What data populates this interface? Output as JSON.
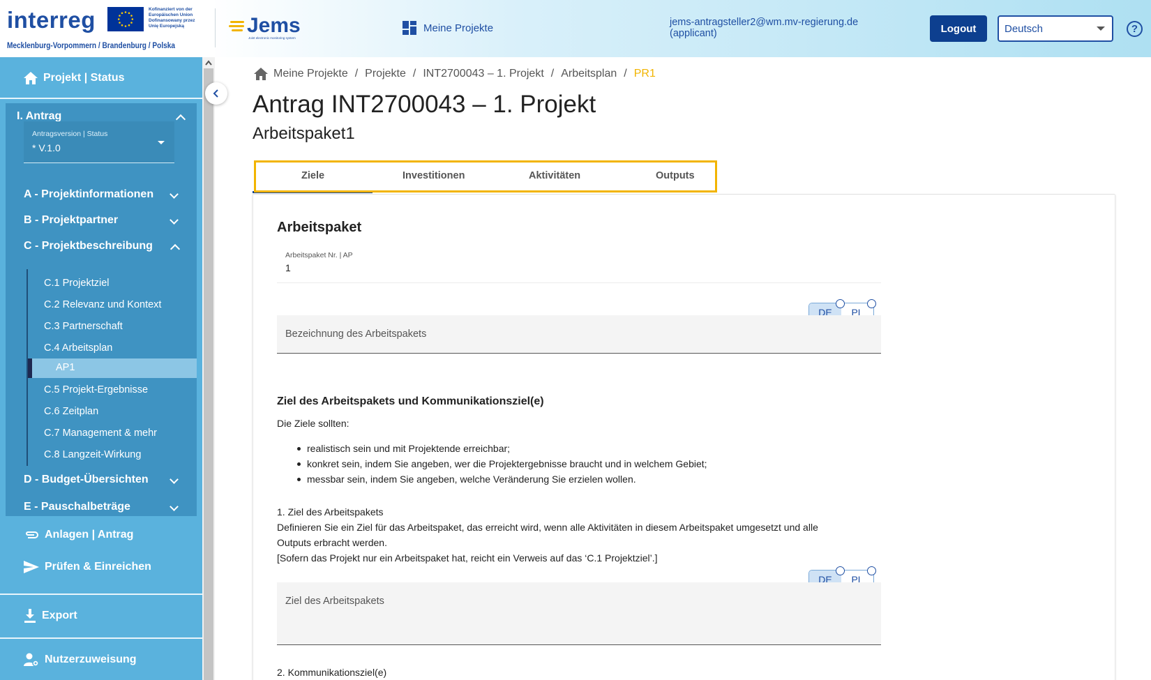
{
  "header": {
    "brand": "interreg",
    "eu_text": [
      "Kofinanziert von der",
      "Europäischen Union",
      "Dofinansowany przez",
      "Unię Europejską"
    ],
    "region": "Mecklenburg-Vorpommern / Brandenburg / Polska",
    "app_name": "Jems",
    "app_tagline": "Joint electronic monitoring system",
    "nav_my_projects": "Meine Projekte",
    "user_email": "jems-antragsteller2@wm.mv-regierung.de",
    "user_role": "(applicant)",
    "logout": "Logout",
    "language": "Deutsch",
    "help": "?"
  },
  "sidebar": {
    "project_status": "Projekt | Status",
    "antrag": "I. Antrag",
    "version_label": "Antragsversion | Status",
    "version_value": "* V.1.0",
    "sections": {
      "a": "A - Projektinformationen",
      "b": "B - Projektpartner",
      "c": "C - Projektbeschreibung",
      "d": "D - Budget-Übersichten",
      "e": "E - Pauschalbeträge"
    },
    "c_items": {
      "c1": "C.1 Projektziel",
      "c2": "C.2 Relevanz und Kontext",
      "c3": "C.3 Partnerschaft",
      "c4": "C.4 Arbeitsplan",
      "ap1": "AP1",
      "c5": "C.5 Projekt-Ergebnisse",
      "c6": "C.6 Zeitplan",
      "c7": "C.7 Management & mehr",
      "c8": "C.8 Langzeit-Wirkung"
    },
    "anlagen": "Anlagen | Antrag",
    "pruefen": "Prüfen & Einreichen",
    "export": "Export",
    "nutzer": "Nutzerzuweisung",
    "colors": {
      "bg": "#5ab2dd",
      "section_bg": "#3f93c2",
      "active": "#8cc6e5"
    }
  },
  "breadcrumb": {
    "home": "Meine Projekte",
    "projekte": "Projekte",
    "project": "INT2700043 – 1. Projekt",
    "plan": "Arbeitsplan",
    "current": "PR1"
  },
  "page": {
    "title": "Antrag INT2700043 – 1. Projekt",
    "subtitle": "Arbeitspaket1"
  },
  "tabs": {
    "ziele": "Ziele",
    "investitionen": "Investitionen",
    "aktivitaeten": "Aktivitäten",
    "outputs": "Outputs",
    "active": "Ziele"
  },
  "form": {
    "card_title": "Arbeitspaket",
    "ap_label": "Arbeitspaket Nr. | AP",
    "ap_value": "1",
    "lang_de": "DE",
    "lang_pl": "PL",
    "name_placeholder": "Bezeichnung des Arbeitspakets",
    "section_title": "Ziel des Arbeitspakets und Kommunikationsziel(e)",
    "intro": "Die Ziele sollten:",
    "bullets": [
      "realistisch sein und mit Projektende erreichbar;",
      "konkret sein, indem Sie angeben, wer die Projektergebnisse braucht und in welchem Gebiet;",
      "messbar sein, indem Sie angeben, welche Veränderung Sie erzielen wollen."
    ],
    "goal_heading": "1. Ziel des Arbeitspakets",
    "goal_text_1": "Definieren Sie ein Ziel für das Arbeitspaket, das erreicht wird, wenn alle Aktivitäten in diesem Arbeitspaket umgesetzt und alle",
    "goal_text_2": "Outputs erbracht werden.",
    "goal_text_3": "[Sofern das Projekt nur ein Arbeitspaket hat, reicht ein Verweis auf das ‘C.1 Projektziel’.]",
    "goal_placeholder": "Ziel des Arbeitspakets",
    "comm_heading": "2. Kommunikationsziel(e)"
  }
}
